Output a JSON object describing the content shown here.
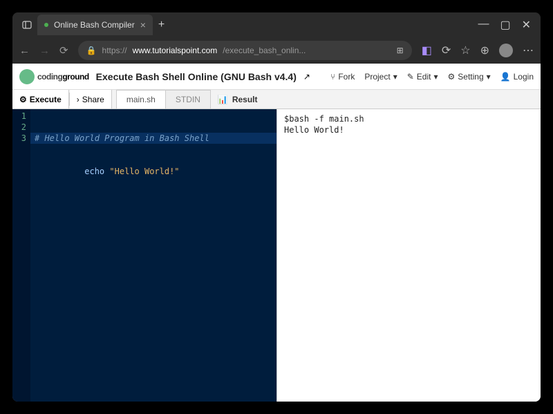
{
  "browser": {
    "tab_title": "Online Bash Compiler",
    "url_host": "www.tutorialspoint.com",
    "url_path": "/execute_bash_onlin..."
  },
  "app": {
    "logo_text": "codingground",
    "page_title": "Execute Bash Shell Online (GNU Bash v4.4)",
    "menu": {
      "fork": "Fork",
      "project": "Project",
      "edit": "Edit",
      "setting": "Setting",
      "login": "Login"
    }
  },
  "toolbar": {
    "execute": "Execute",
    "share": "Share",
    "tabs": {
      "main": "main.sh",
      "stdin": "STDIN"
    },
    "result_label": "Result"
  },
  "editor": {
    "lines": {
      "l1": "# Hello World Program in Bash Shell",
      "l2": "",
      "l3_cmd": "echo",
      "l3_str": "\"Hello World!\""
    },
    "gutter": {
      "n1": "1",
      "n2": "2",
      "n3": "3"
    }
  },
  "result": {
    "line1": "$bash -f main.sh",
    "line2": "Hello World!"
  }
}
